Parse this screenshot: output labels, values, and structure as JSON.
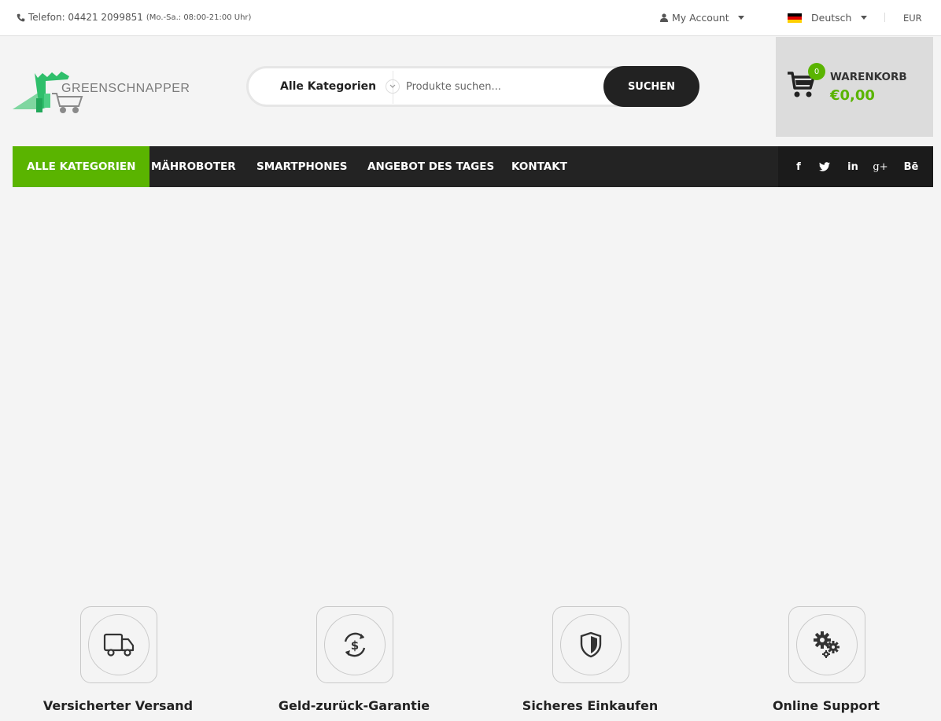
{
  "topbar": {
    "phone_label": "Telefon: 04421 2099851",
    "phone_hours": "(Mo.-Sa.: 08:00-21:00 Uhr)",
    "account_label": "My Account",
    "language_label": "Deutsch",
    "currency_label": "EUR"
  },
  "header": {
    "logo_text": "GREENSCHNAPPER",
    "search": {
      "category_label": "Alle Kategorien",
      "placeholder": "Produkte suchen...",
      "button_label": "SUCHEN"
    },
    "cart": {
      "count": "0",
      "label": "WARENKORB",
      "total": "€0,00"
    }
  },
  "nav": {
    "items": [
      {
        "label": "ALLE KATEGORIEN"
      },
      {
        "label": "MÄHROBOTER"
      },
      {
        "label": "SMARTPHONES"
      },
      {
        "label": "ANGEBOT DES TAGES"
      },
      {
        "label": "KONTAKT"
      }
    ],
    "social": [
      {
        "icon": "facebook-icon",
        "glyph": "f"
      },
      {
        "icon": "twitter-icon",
        "glyph": ""
      },
      {
        "icon": "linkedin-icon",
        "glyph": "in"
      },
      {
        "icon": "google-plus-icon",
        "glyph": "g+"
      },
      {
        "icon": "behance-icon",
        "glyph": "Bē"
      }
    ]
  },
  "features": [
    {
      "title": "Versicherter Versand",
      "icon": "truck-icon"
    },
    {
      "title": "Geld-zurück-Garantie",
      "icon": "money-back-icon"
    },
    {
      "title": "Sicheres Einkaufen",
      "icon": "shield-icon"
    },
    {
      "title": "Online Support",
      "icon": "gears-icon"
    }
  ],
  "colors": {
    "accent": "#5ab400",
    "dark": "#232323",
    "background": "#f4f4f4"
  }
}
